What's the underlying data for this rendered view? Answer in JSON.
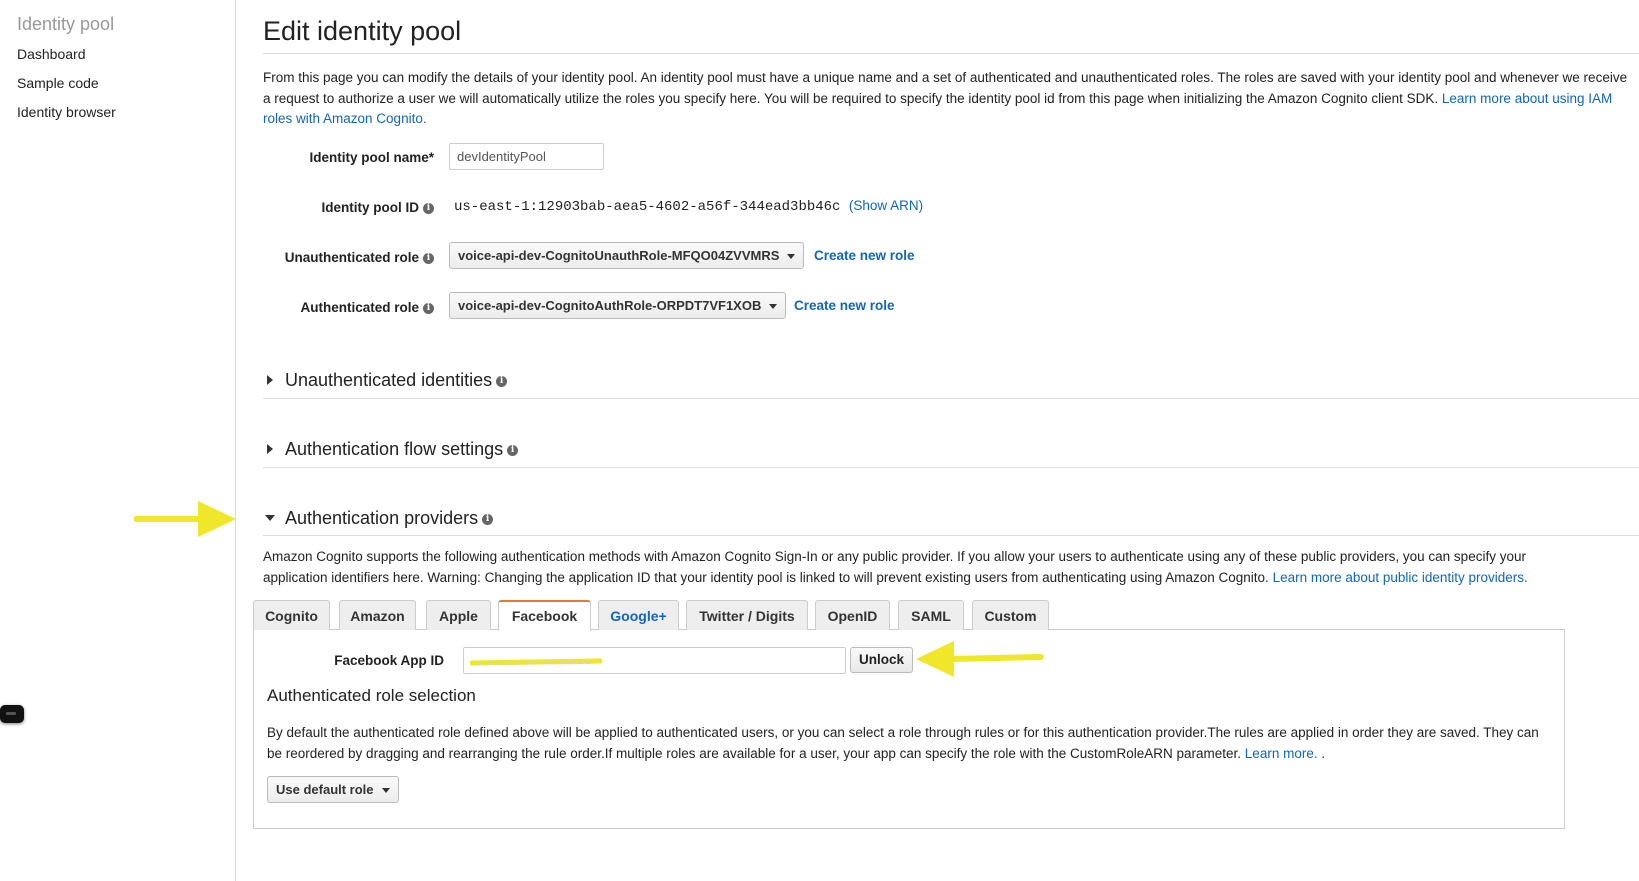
{
  "sidebar": {
    "title": "Identity pool",
    "items": [
      {
        "label": "Dashboard"
      },
      {
        "label": "Sample code"
      },
      {
        "label": "Identity browser"
      }
    ]
  },
  "page": {
    "title": "Edit identity pool",
    "intro": "From this page you can modify the details of your identity pool. An identity pool must have a unique name and a set of authenticated and unauthenticated roles. The roles are saved with your identity pool and whenever we receive a request to authorize a user we will automatically utilize the roles you specify here. You will be required to specify the identity pool id from this page when initializing the Amazon Cognito client SDK.",
    "intro_link": "Learn more about using IAM roles with Amazon Cognito."
  },
  "form": {
    "pool_name_label": "Identity pool name*",
    "pool_name_value": "devIdentityPool",
    "pool_id_label": "Identity pool ID",
    "pool_id_value": "us-east-1:12903bab-aea5-4602-a56f-344ead3bb46c",
    "show_arn": "(Show ARN)",
    "unauth_role_label": "Unauthenticated role",
    "unauth_role_value": "voice-api-dev-CognitoUnauthRole-MFQO04ZVVMRS",
    "auth_role_label": "Authenticated role",
    "auth_role_value": "voice-api-dev-CognitoAuthRole-ORPDT7VF1XOB",
    "create_new_role": "Create new role"
  },
  "sections": {
    "unauth_identities": "Unauthenticated identities",
    "auth_flow": "Authentication flow settings",
    "auth_providers": "Authentication providers"
  },
  "providers": {
    "description": "Amazon Cognito supports the following authentication methods with Amazon Cognito Sign-In or any public provider. If you allow your users to authenticate using any of these public providers, you can specify your application identifiers here. Warning: Changing the application ID that your identity pool is linked to will prevent existing users from authenticating using Amazon Cognito.",
    "description_link": "Learn more about public identity providers.",
    "tabs": [
      "Cognito",
      "Amazon",
      "Apple",
      "Facebook",
      "Google+",
      "Twitter / Digits",
      "OpenID",
      "SAML",
      "Custom"
    ],
    "active_tab": "Facebook",
    "facebook_app_id_label": "Facebook App ID",
    "unlock_label": "Unlock",
    "role_selection_title": "Authenticated role selection",
    "role_selection_text": "By default the authenticated role defined above will be applied to authenticated users, or you can select a role through rules or for this authentication provider.The rules are applied in order they are saved. They can be reordered by dragging and rearranging the rule order.If multiple roles are available for a user, your app can specify the role with the CustomRoleARN parameter.",
    "learn_more": "Learn more.",
    "learn_more_suffix": " .",
    "role_dropdown": "Use default role"
  },
  "colors": {
    "link": "#1166bb",
    "active_tab_accent": "#e8792f",
    "annotation_arrow": "#f0e62a"
  }
}
